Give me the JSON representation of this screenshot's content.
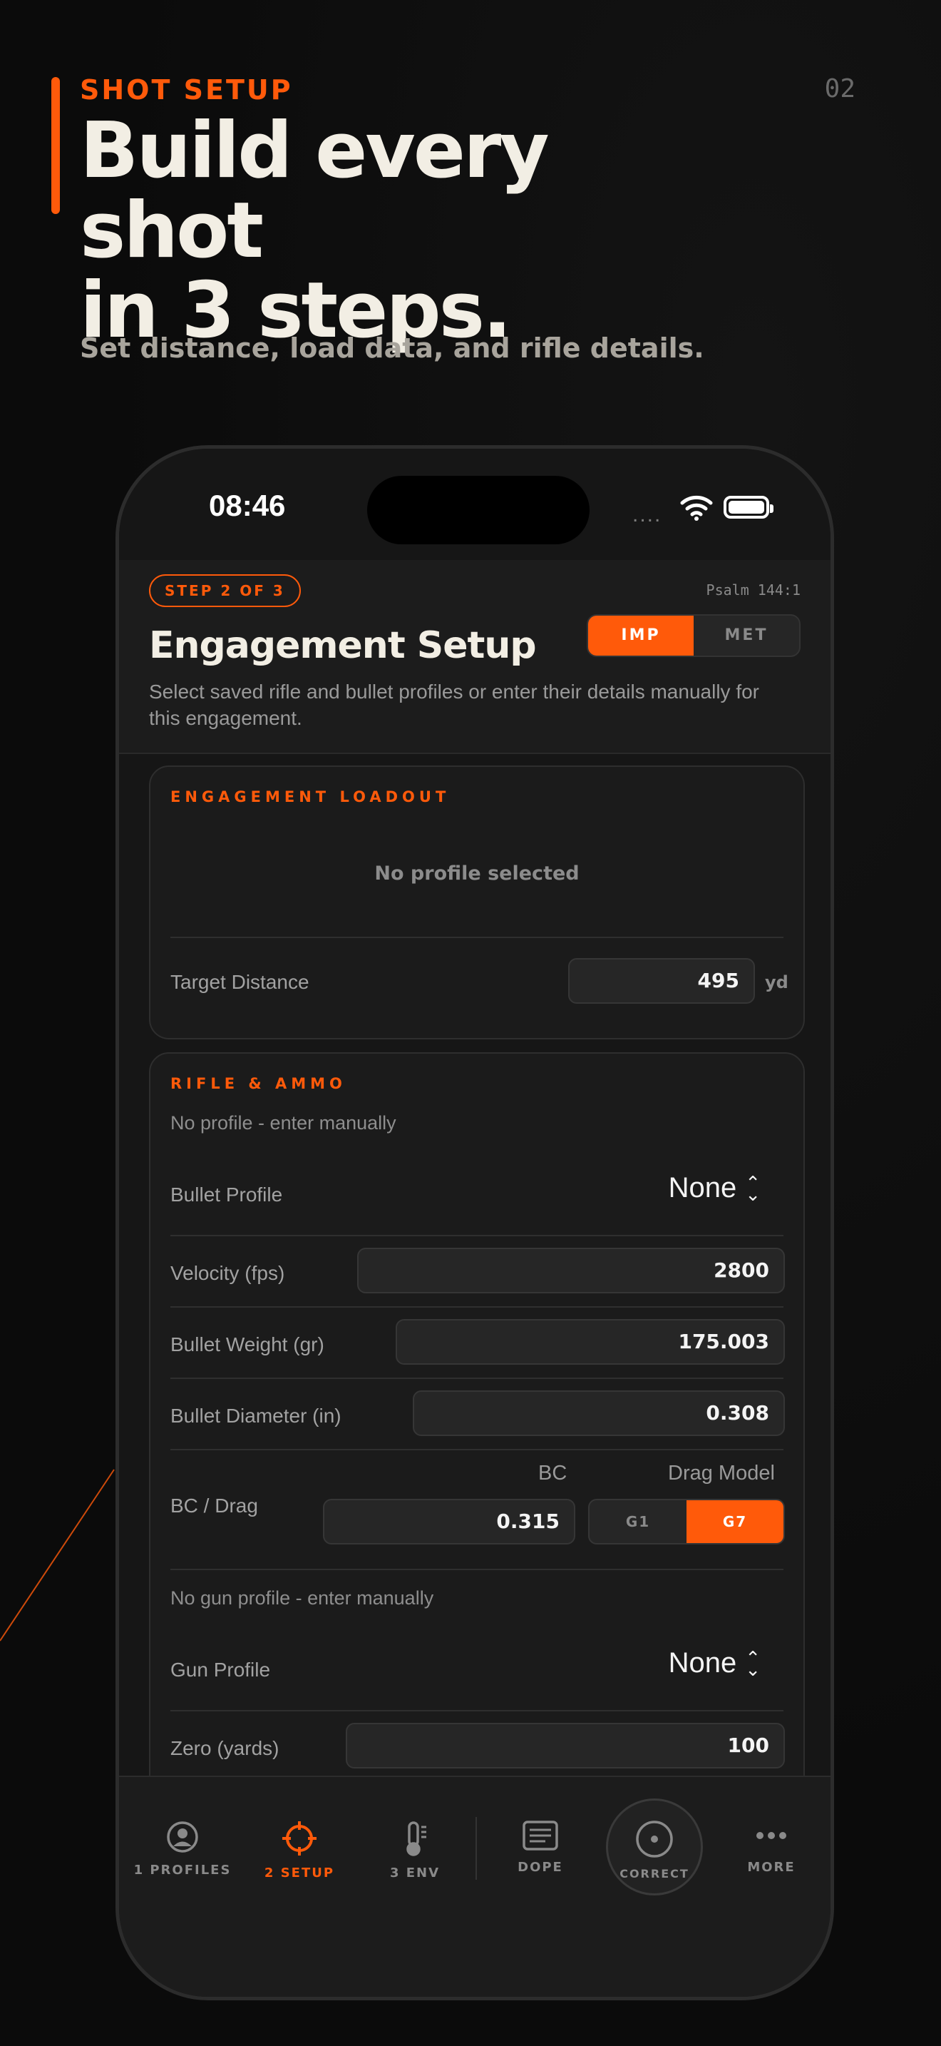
{
  "promo": {
    "eyebrow": "SHOT SETUP",
    "page_number": "02",
    "headline_line1": "Build every shot",
    "headline_line2": "in 3 steps.",
    "subhead": "Set distance, load data, and rifle details."
  },
  "status_bar": {
    "time": "08:46",
    "signal": "....",
    "icons": [
      "wifi-icon",
      "battery-icon"
    ]
  },
  "header": {
    "step": "STEP 2 OF 3",
    "verse": "Psalm 144:1",
    "title": "Engagement Setup",
    "description": "Select saved rifle and bullet profiles or enter their details manually for this engagement.",
    "unit_toggle": {
      "options": [
        "IMP",
        "MET"
      ],
      "selected": "IMP"
    }
  },
  "loadout": {
    "title": "ENGAGEMENT LOADOUT",
    "empty": "No profile selected",
    "distance_label": "Target Distance",
    "distance_value": "495",
    "distance_unit": "yd"
  },
  "rifle_ammo": {
    "title": "RIFLE & AMMO",
    "note": "No profile - enter manually",
    "bullet_profile_label": "Bullet Profile",
    "bullet_profile_value": "None",
    "velocity_label": "Velocity (fps)",
    "velocity_value": "2800",
    "weight_label": "Bullet Weight (gr)",
    "weight_value": "175.003",
    "diameter_label": "Bullet Diameter (in)",
    "diameter_value": "0.308",
    "bc_drag_label": "BC / Drag",
    "bc_head": "BC",
    "bc_value": "0.315",
    "drag_head": "Drag Model",
    "drag_options": [
      "G1",
      "G7"
    ],
    "drag_selected": "G7",
    "gun_note": "No gun profile - enter manually",
    "gun_profile_label": "Gun Profile",
    "gun_profile_value": "None",
    "zero_label": "Zero (yards)",
    "zero_value": "100"
  },
  "tabbar": {
    "profiles": "1 PROFILES",
    "setup": "2 SETUP",
    "env": "3 ENV",
    "dope": "DOPE",
    "correct": "CORRECT",
    "more": "MORE",
    "active": "setup"
  },
  "colors": {
    "accent": "#ff5a0a",
    "background": "#0b0b0b",
    "card": "#1b1b1b",
    "text_primary": "#f2eee4",
    "text_muted": "#9a9a9a"
  }
}
